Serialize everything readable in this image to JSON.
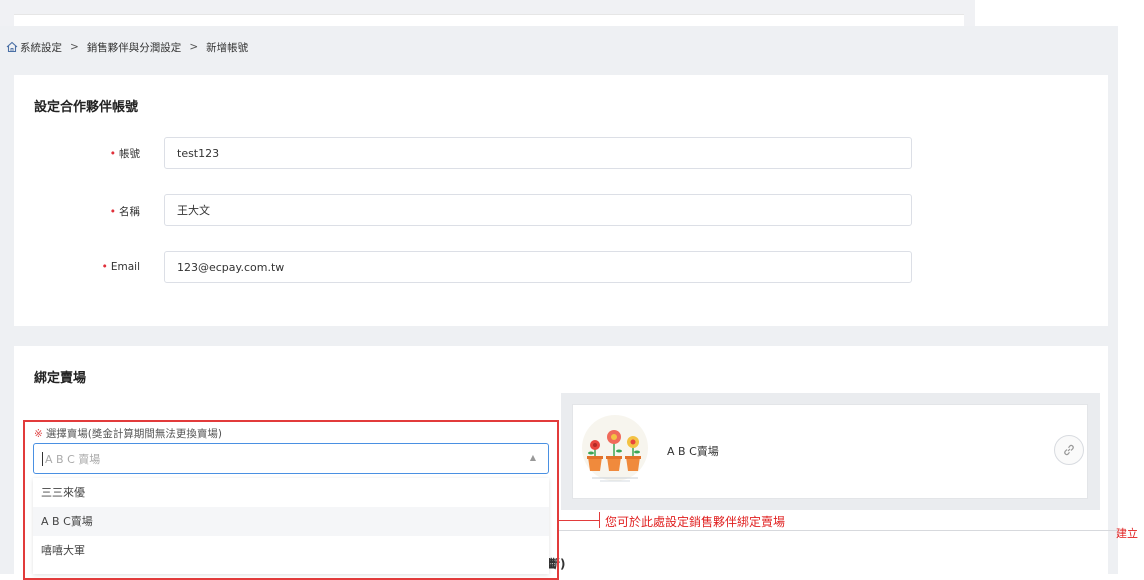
{
  "breadcrumb": {
    "items": [
      "系統設定",
      "銷售夥伴與分潤設定",
      "新增帳號"
    ],
    "separator": ">"
  },
  "partner_section": {
    "title": "設定合作夥伴帳號",
    "fields": [
      {
        "label": "帳號",
        "value": "test123"
      },
      {
        "label": "名稱",
        "value": "王大文"
      },
      {
        "label": "Email",
        "value": "123@ecpay.com.tw"
      }
    ]
  },
  "store_section": {
    "title": "綁定賣場",
    "select_label_mark": "※",
    "select_label": "選擇賣場(獎金計算期間無法更換賣場)",
    "select_placeholder": "A B C 賣場",
    "dropdown_options": [
      "三三來優",
      "A B C賣場",
      "嘻嘻大軍"
    ],
    "hovered_option_index": 1,
    "selected_store_name": "A B C賣場",
    "clipped_text": "斷)"
  },
  "annotations": {
    "callout": "您可於此處設定銷售夥伴綁定賣場",
    "right_edge": "建立"
  },
  "icons": {
    "home": "home-icon",
    "link": "link-icon",
    "dropdown_arrow": "chevron-up-icon"
  },
  "colors": {
    "required": "#e0303a",
    "annotation": "#e02020",
    "focus": "#4a90e2",
    "page_bg": "#eef0f3"
  }
}
